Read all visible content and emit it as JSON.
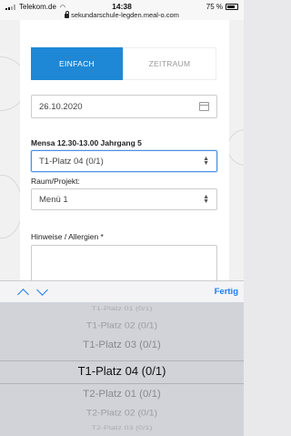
{
  "status_bar": {
    "carrier": "Telekom.de",
    "time": "14:38",
    "battery": "75 %",
    "url": "sekundarschule-legden.meal-o.com"
  },
  "form": {
    "tabs": [
      {
        "label": "EINFACH",
        "active": true
      },
      {
        "label": "ZEITRAUM",
        "active": false
      }
    ],
    "date_value": "26.10.2020",
    "mensa_label": "Mensa 12.30-13.00 Jahrgang 5",
    "mensa_value": "T1-Platz 04 (0/1)",
    "raum_label": "Raum/Projekt:",
    "raum_value": "Menü 1",
    "hinweise_label": "Hinweise / Allergien *"
  },
  "keyboard_accessory": {
    "done_label": "Fertig"
  },
  "picker": {
    "options": [
      "T1-Platz 01 (0/1)",
      "T1-Platz 02 (0/1)",
      "T1-Platz 03 (0/1)",
      "T1-Platz 04 (0/1)",
      "T2-Platz 01 (0/1)",
      "T2-Platz 02 (0/1)",
      "T2-Platz 03 (0/1)"
    ],
    "selected_index": 3
  },
  "colors": {
    "accent": "#1e88d6",
    "ios_blue": "#1e7cf2",
    "picker_bg": "#d1d3d9"
  }
}
